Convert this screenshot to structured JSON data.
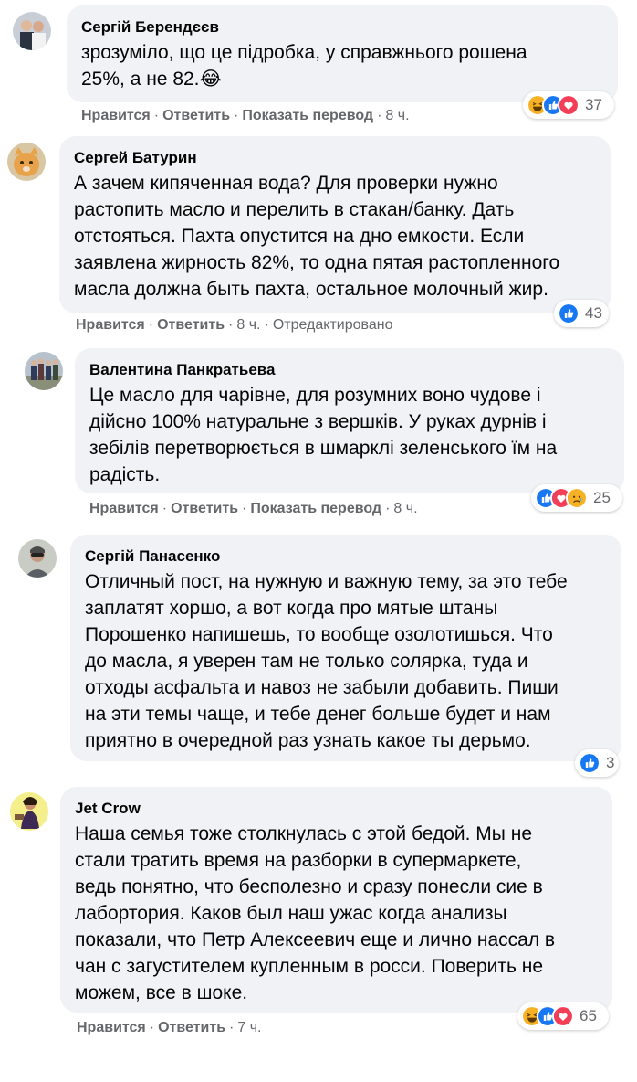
{
  "actions": {
    "like": "Нравится",
    "reply": "Ответить",
    "translate": "Показать перевод",
    "edited": "Отредактировано"
  },
  "reaction_colors": {
    "like": "#1877f2",
    "love": "#f33e58",
    "haha": "#f7b125",
    "sad": "#f7b125"
  },
  "comments": [
    {
      "author": "Сергій Берендєєв",
      "text": "зрозуміло, що це підробка, у справжнього рошена\n25%, а не 82.😂",
      "time": "8 ч.",
      "reaction_icons": [
        "haha-icon",
        "like-icon",
        "love-icon"
      ],
      "reaction_count": "37"
    },
    {
      "author": "Сергей Батурин",
      "text": "А зачем кипяченная вода? Для проверки нужно\nрастопить масло и перелить в стакан/банку. Дать\nотстояться. Пахта опустится на дно емкости. Если\nзаявлена жирность 82%, то одна пятая растопленного\nмасла должна быть пахта, остальное молочный жир.",
      "time": "8 ч.",
      "reaction_icons": [
        "like-icon"
      ],
      "reaction_count": "43"
    },
    {
      "author": "Валентина Панкратьева",
      "text": "Це масло для чарівне, для розумних воно чудове і\nдійсно 100% натуральне з вершків. У руках дурнів і\nзебілів перетворюється в шмарклі зеленського їм на\nрадість.",
      "time": "8 ч.",
      "reaction_icons": [
        "like-icon",
        "love-icon",
        "sad-icon"
      ],
      "reaction_count": "25"
    },
    {
      "author": "Сергій Панасенко",
      "text": "Отличный пост, на нужную и важную тему, за это тебе\nзаплатят хоршо, а вот когда про мятые штаны\nПорошенко напишешь, то вообще озолотишься. Что\nдо масла, я уверен там не только солярка, туда и\nотходы асфальта и навоз не забыли добавить. Пиши\nна эти темы чаще, и тебе денег больше будет и нам\nприятно в очередной раз узнать какое ты дерьмо.",
      "time": "",
      "reaction_icons": [
        "like-icon"
      ],
      "reaction_count": "3"
    },
    {
      "author": "Jet Crow",
      "text": "Наша семья тоже столкнулась с этой бедой. Мы не\nстали тратить время на разборки в супермаркете,\nведь понятно, что бесполезно и сразу понесли сие в\nлабортория. Каков был наш ужас когда анализы\nпоказали, что Петр Алексеевич еще и лично нассал в\nчан с загустителем купленным в росси. Поверить не\nможем, все в шоке.",
      "time": "7 ч.",
      "reaction_icons": [
        "haha-icon",
        "like-icon",
        "love-icon"
      ],
      "reaction_count": "65"
    }
  ]
}
